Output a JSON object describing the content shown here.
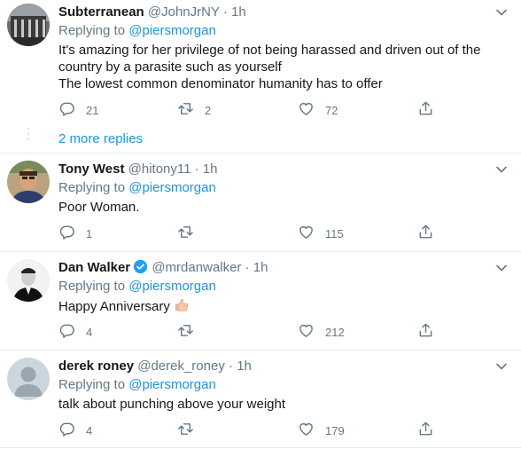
{
  "tweets": [
    {
      "name": "Subterranean",
      "handle": "@JohnJrNY",
      "separator": "·",
      "time": "1h",
      "replying_prefix": "Replying to",
      "replying_to": "@piersmorgan",
      "text_lines": [
        "It's amazing for her privilege of not being harassed and driven out of the",
        "country by a parasite such as yourself",
        "The lowest common denominator humanity has to offer"
      ],
      "replies": "21",
      "retweets": "2",
      "likes": "72"
    },
    {
      "name": "Tony West",
      "handle": "@hitony11",
      "separator": "·",
      "time": "1h",
      "replying_prefix": "Replying to",
      "replying_to": "@piersmorgan",
      "text_lines": [
        "Poor Woman."
      ],
      "replies": "1",
      "retweets": "",
      "likes": "115"
    },
    {
      "name": "Dan Walker",
      "handle": "@mrdanwalker",
      "separator": "·",
      "time": "1h",
      "replying_prefix": "Replying to",
      "replying_to": "@piersmorgan",
      "text_lines": [
        "Happy Anniversary"
      ],
      "replies": "4",
      "retweets": "",
      "likes": "212"
    },
    {
      "name": "derek roney",
      "handle": "@derek_roney",
      "separator": "·",
      "time": "1h",
      "replying_prefix": "Replying to",
      "replying_to": "@piersmorgan",
      "text_lines": [
        "talk about punching above your weight"
      ],
      "replies": "4",
      "retweets": "",
      "likes": "179"
    }
  ],
  "more_replies": "2 more replies",
  "colors": {
    "link": "#1b95e0",
    "muted": "#657786",
    "text": "#14171a",
    "divider": "#e6ecf0",
    "verified": "#1da1f2"
  },
  "icons": {
    "reply": "reply-icon",
    "retweet": "retweet-icon",
    "like": "heart-icon",
    "share": "share-icon",
    "caret": "chevron-down-icon",
    "verified": "verified-badge-icon",
    "emoji": "thumbs-up-emoji"
  }
}
